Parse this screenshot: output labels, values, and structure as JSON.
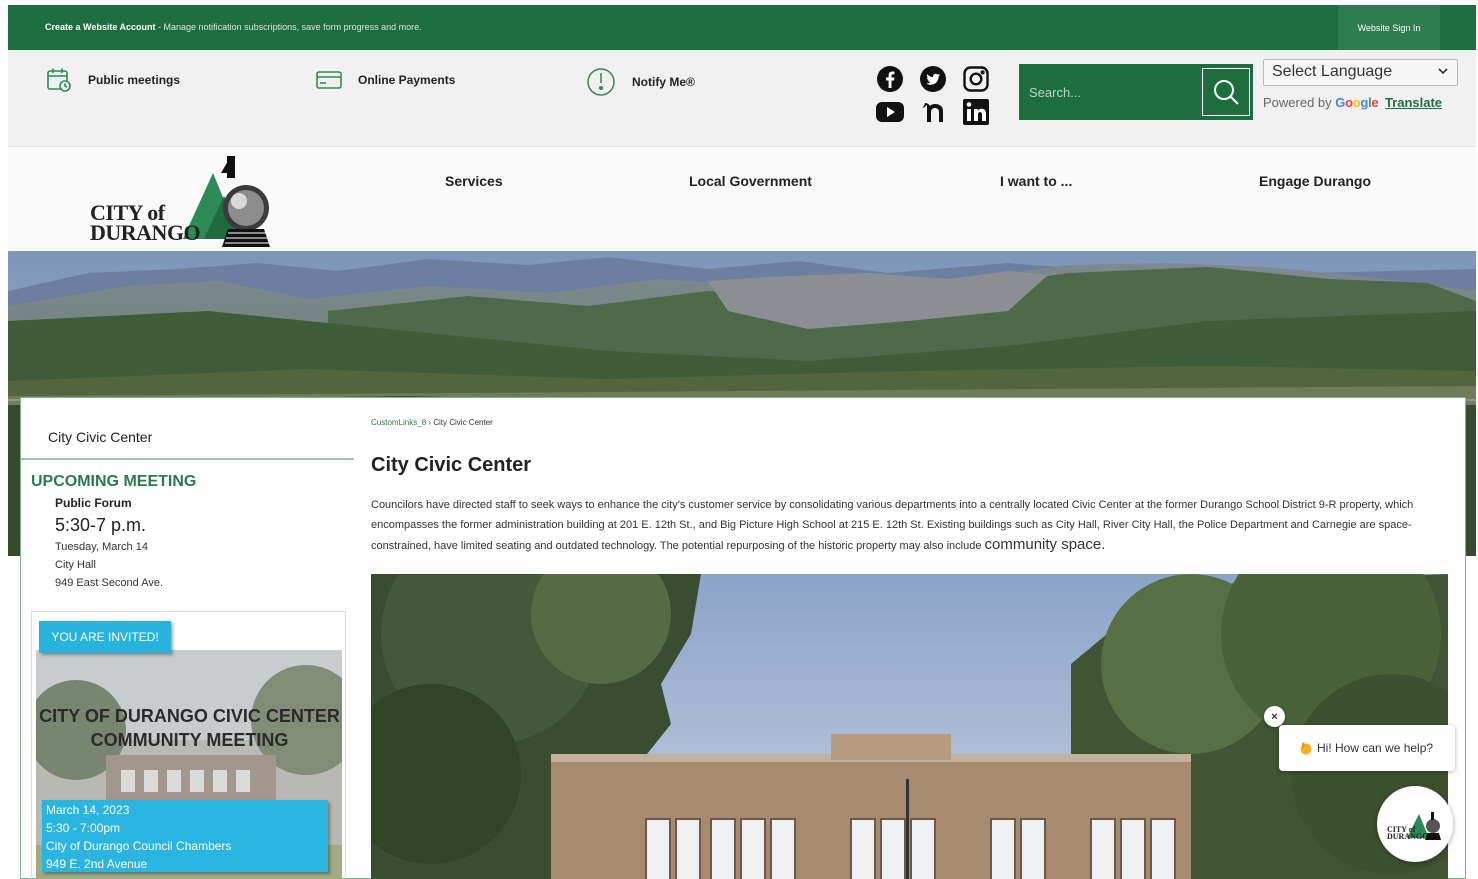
{
  "topbar": {
    "account_link": "Create a Website Account",
    "account_desc": " - Manage notification subscriptions, save form progress and more.",
    "signin": "Website Sign In"
  },
  "utility": {
    "links": [
      {
        "label": "Public meetings",
        "icon": "calendar-icon"
      },
      {
        "label": "Online Payments",
        "icon": "credit-card-icon"
      },
      {
        "label": "Notify Me®",
        "icon": "notification-icon"
      }
    ],
    "social": [
      "facebook-icon",
      "twitter-icon",
      "instagram-icon",
      "youtube-icon",
      "nextdoor-icon",
      "linkedin-icon"
    ],
    "search_placeholder": "Search...",
    "language_select": "Select Language",
    "powered_by": "Powered by",
    "google": "Google",
    "translate": "Translate"
  },
  "header": {
    "logo_line1": "CITY of",
    "logo_line2": "DURANGO",
    "nav": [
      "Services",
      "Local Government",
      "I want to ...",
      "Engage Durango"
    ]
  },
  "sidebar": {
    "title": "City Civic Center",
    "upcoming_heading": "UPCOMING MEETING",
    "event_name": "Public Forum",
    "event_time": "5:30-7 p.m.",
    "event_date": "Tuesday, March 14",
    "event_place": "City Hall",
    "event_address": "949 East Second Ave.",
    "invite": {
      "tag": "YOU ARE INVITED!",
      "headline1": "CITY OF DURANGO CIVIC CENTER",
      "headline2": "COMMUNITY MEETING",
      "line1": "March 14, 2023",
      "line2": "5:30 - 7:00pm",
      "line3": "City of Durango Council Chambers",
      "line4": "949 E. 2nd Avenue"
    }
  },
  "main": {
    "breadcrumb_link": "CustomLinks_8",
    "breadcrumb_sep": " › ",
    "breadcrumb_current": "City Civic Center",
    "title": "City Civic Center",
    "body": "Councilors have directed staff to seek ways to enhance the city's customer service by consolidating various departments into a centrally located Civic Center at the former Durango School District 9-R property, which encompasses the former administration building at 201 E. 12th St., and Big Picture High School at 215 E. 12th St. Existing buildings such as City Hall, River City Hall, the Police Department and Carnegie are space-constrained, have limited seating and outdated technology. The potential repurposing of the historic property may also include ",
    "body_big": "community space."
  },
  "chat": {
    "close": "×",
    "greeting": "Hi! How can we help?"
  },
  "colors": {
    "brand_green": "#1e6d3f",
    "accent_green": "#2a7b4c",
    "invite_blue": "#29b5e0"
  }
}
